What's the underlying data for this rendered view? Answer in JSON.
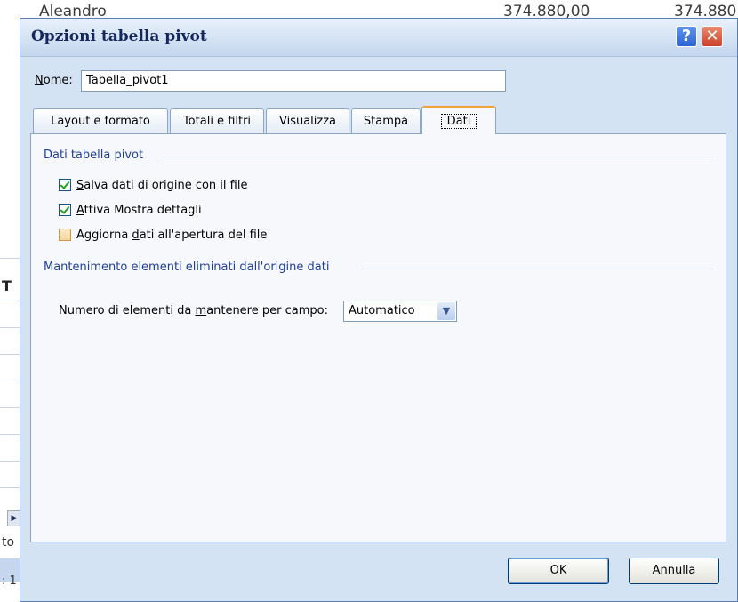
{
  "background": {
    "row_name": "Aleandro",
    "row_value1": "374.880,00",
    "row_value2": "374.880",
    "left_header": "T",
    "left_text1": "to",
    "left_text2": ": 1"
  },
  "dialog": {
    "title": "Opzioni tabella pivot",
    "help_label": "?",
    "close_label": "✕",
    "name_label_prefix": "N",
    "name_label_rest": "ome:",
    "name_value": "Tabella_pivot1",
    "tabs": [
      {
        "label": "Layout e formato"
      },
      {
        "label": "Totali e filtri"
      },
      {
        "label": "Visualizza"
      },
      {
        "label": "Stampa"
      },
      {
        "label": "Dati",
        "active": true
      }
    ],
    "group1_title": "Dati tabella pivot",
    "checkboxes": [
      {
        "accel": "S",
        "rest": "alva dati di origine con il file",
        "checked": true
      },
      {
        "accel": "A",
        "rest": "ttiva Mostra dettagli",
        "checked": true
      },
      {
        "pre": "Aggiorna ",
        "accel": "d",
        "rest": "ati all'apertura del file",
        "checked": false
      }
    ],
    "group2_title": "Mantenimento elementi eliminati dall'origine dati",
    "retain_label_pre": "Numero di elementi da ",
    "retain_label_accel": "m",
    "retain_label_rest": "antenere per campo:",
    "retain_value": "Automatico",
    "ok_label": "OK",
    "cancel_label": "Annulla"
  }
}
